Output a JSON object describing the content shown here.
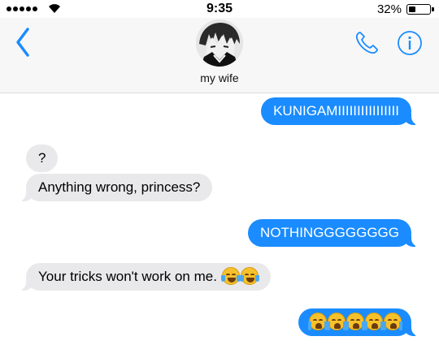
{
  "status_bar": {
    "time": "9:35",
    "battery": "32%",
    "battery_level": 0.32
  },
  "header": {
    "contact_name": "my wife",
    "icons": {
      "back": "chevron-left-icon",
      "call": "phone-icon",
      "info": "info-icon"
    },
    "accent_color": "#1a8cff"
  },
  "messages": [
    {
      "direction": "sent",
      "text": "KUNIGAMIIIIIIIIIIIIIIII"
    },
    {
      "direction": "received",
      "text": "?"
    },
    {
      "direction": "received",
      "text": "Anything wrong, princess?"
    },
    {
      "direction": "sent",
      "text": "NOTHINGGGGGGGG"
    },
    {
      "direction": "received",
      "text": "Your tricks won't work on me.",
      "emoji": [
        "face-with-tears-of-joy",
        "face-with-tears-of-joy"
      ]
    },
    {
      "direction": "sent",
      "text": "",
      "emoji": [
        "loudly-crying-face",
        "loudly-crying-face",
        "loudly-crying-face",
        "loudly-crying-face",
        "loudly-crying-face"
      ]
    }
  ],
  "colors": {
    "sent_bubble": "#1a8cff",
    "received_bubble": "#e9e9eb"
  }
}
